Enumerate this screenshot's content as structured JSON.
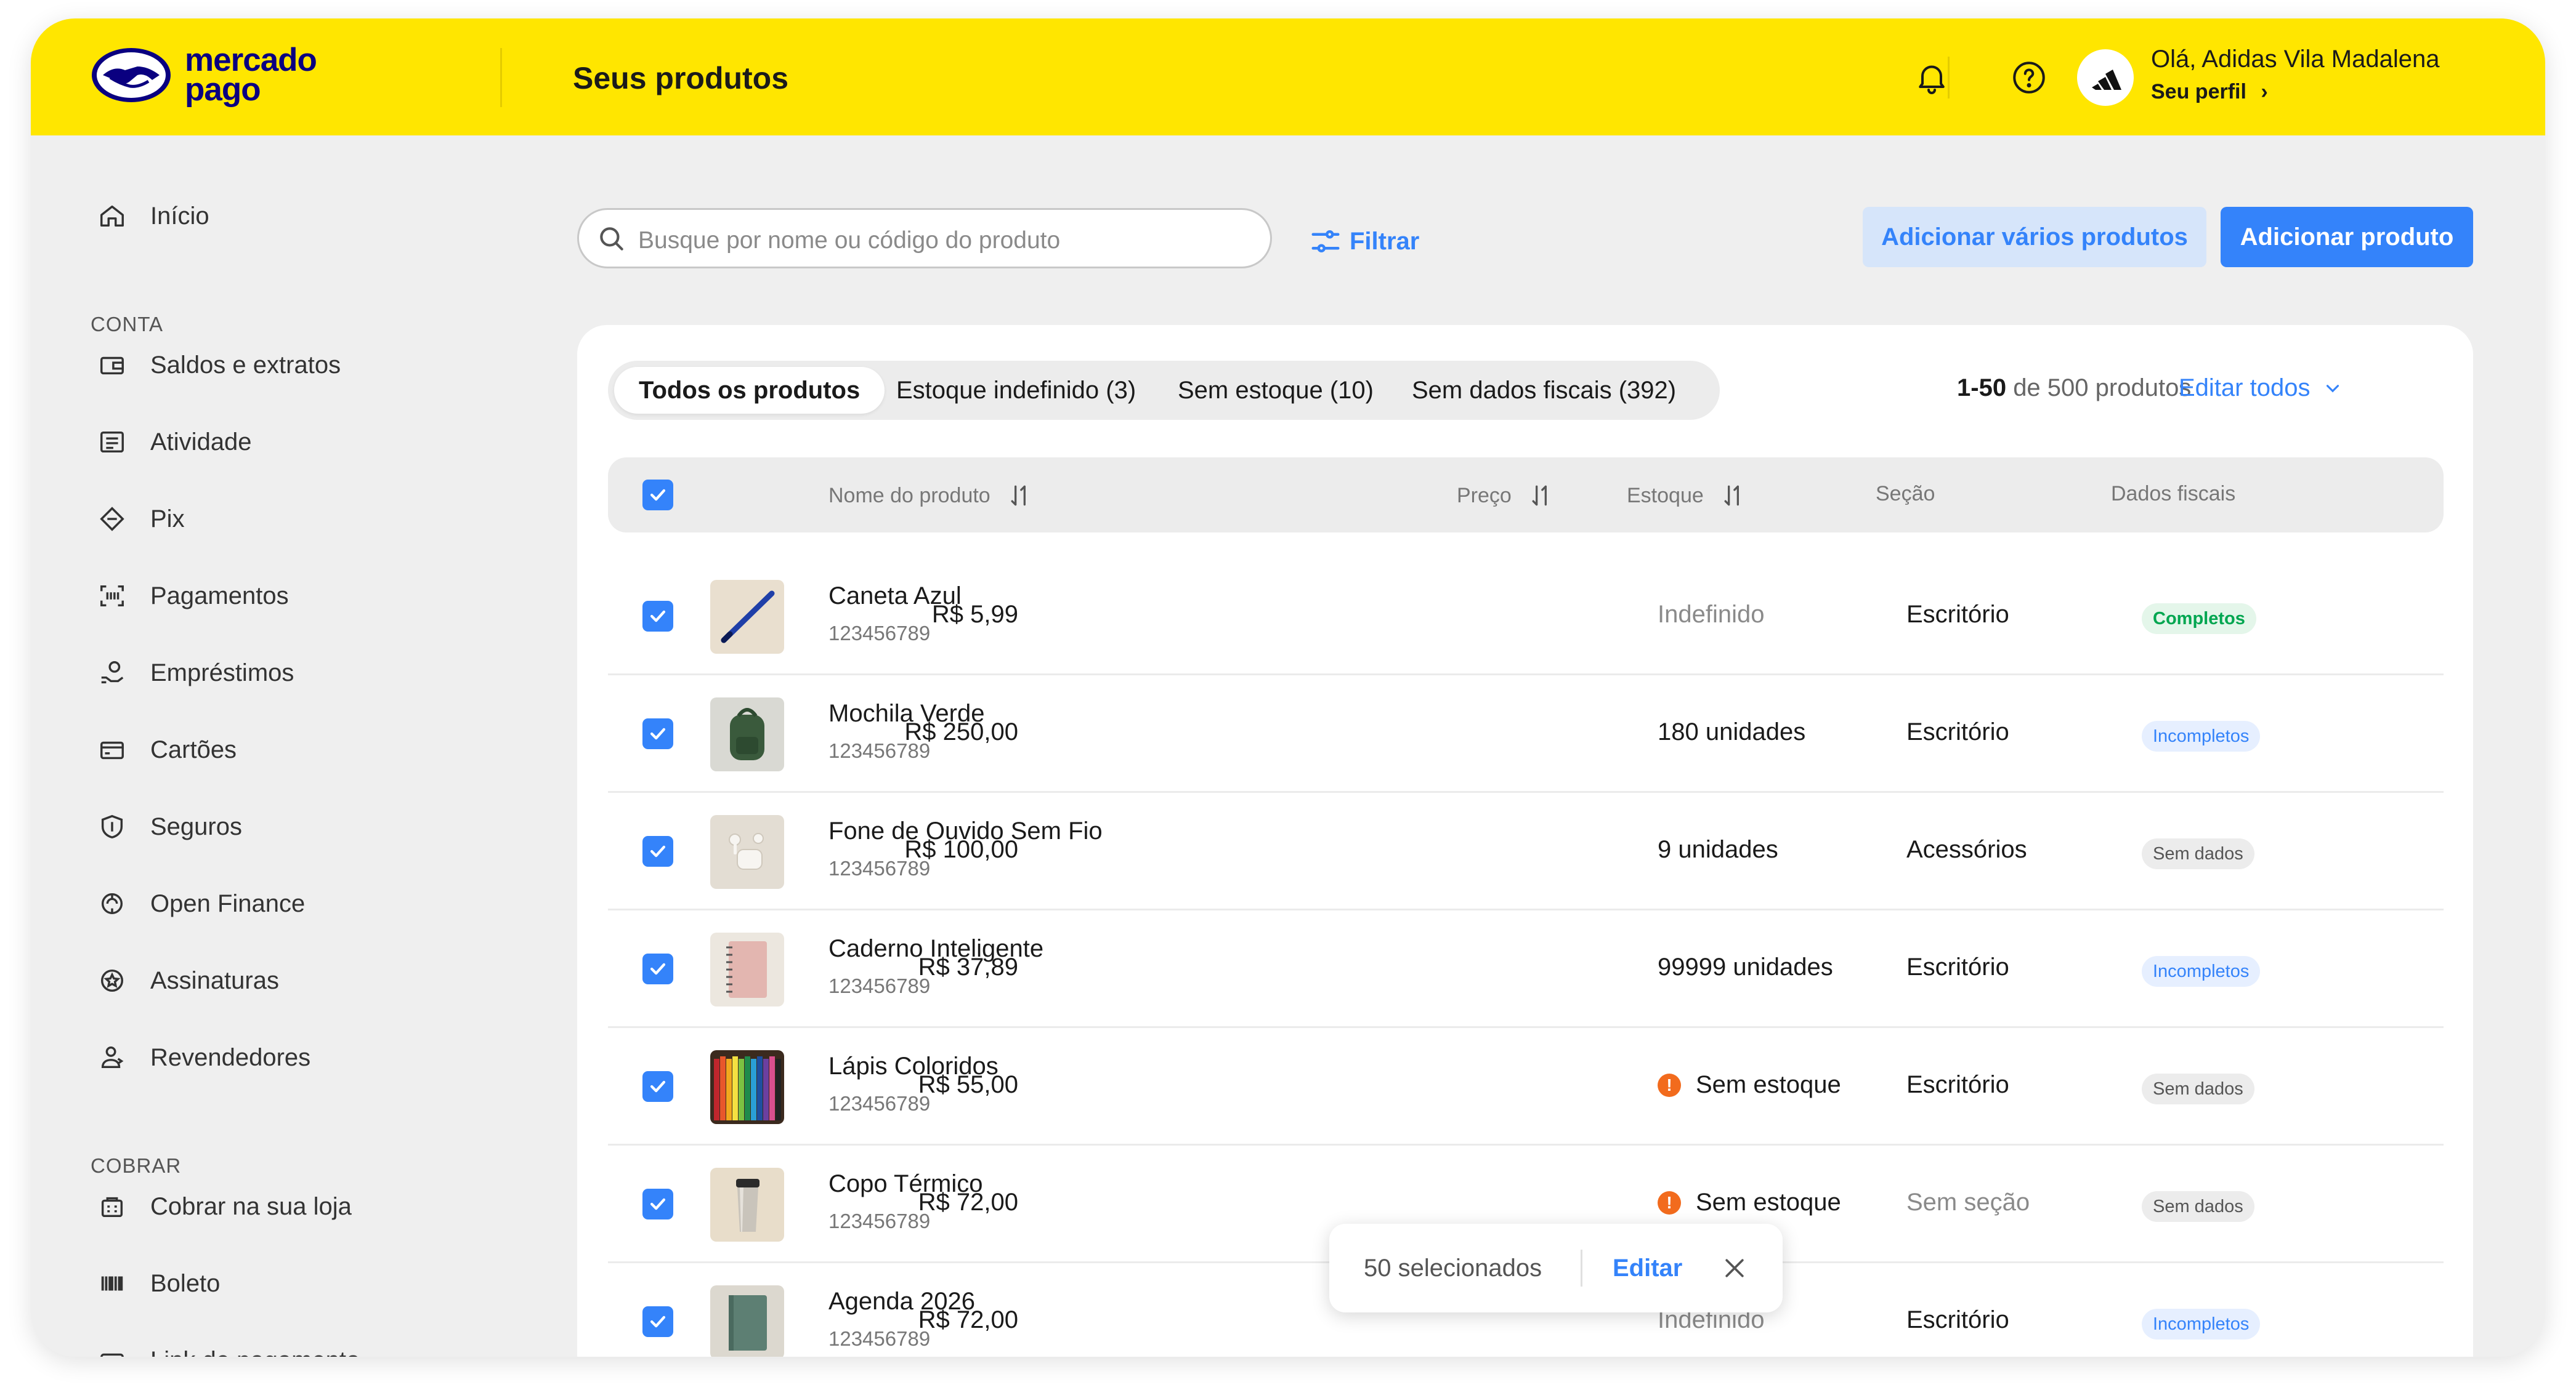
{
  "header": {
    "logo_line1": "mercado",
    "logo_line2": "pago",
    "title": "Seus produtos",
    "greeting": "Olá, Adidas Vila Madalena",
    "profile_link": "Seu perfil",
    "notification_icon": "bell-icon",
    "help_icon": "help-circle-icon",
    "brand_color": "#ffe600"
  },
  "sidebar": {
    "home": {
      "label": "Início",
      "icon": "home-icon"
    },
    "section_account": "CONTA",
    "account_items": [
      {
        "label": "Saldos e extratos",
        "icon": "wallet-icon"
      },
      {
        "label": "Atividade",
        "icon": "list-icon"
      },
      {
        "label": "Pix",
        "icon": "pix-icon"
      },
      {
        "label": "Pagamentos",
        "icon": "scan-icon"
      },
      {
        "label": "Empréstimos",
        "icon": "loan-icon"
      },
      {
        "label": "Cartões",
        "icon": "card-icon"
      },
      {
        "label": "Seguros",
        "icon": "shield-icon"
      },
      {
        "label": "Open Finance",
        "icon": "open-finance-icon"
      },
      {
        "label": "Assinaturas",
        "icon": "subscription-icon"
      },
      {
        "label": "Revendedores",
        "icon": "resellers-icon"
      }
    ],
    "section_charge": "COBRAR",
    "charge_items": [
      {
        "label": "Cobrar na sua loja",
        "icon": "store-icon"
      },
      {
        "label": "Boleto",
        "icon": "barcode-icon"
      },
      {
        "label": "Link de pagamento",
        "icon": "link-icon"
      }
    ]
  },
  "toolbar": {
    "search_placeholder": "Busque por nome ou código do produto",
    "filter_label": "Filtrar",
    "add_many_label": "Adicionar vários produtos",
    "add_product_label": "Adicionar produto"
  },
  "tabs": [
    {
      "label": "Todos os produtos",
      "active": true
    },
    {
      "label": "Estoque indefinido (3)",
      "active": false
    },
    {
      "label": "Sem estoque (10)",
      "active": false
    },
    {
      "label": "Sem dados fiscais (392)",
      "active": false
    }
  ],
  "pagination": {
    "range": "1-50",
    "suffix": "de 500 produtos"
  },
  "edit_all_label": "Editar todos",
  "table": {
    "columns": {
      "name": "Nome do produto",
      "price": "Preço",
      "stock": "Estoque",
      "section": "Seção",
      "fiscal": "Dados fiscais"
    },
    "rows": [
      {
        "name": "Caneta Azul",
        "code": "123456789",
        "price": "R$ 5,99",
        "stock": "Indefinido",
        "stock_state": "undefined",
        "section": "Escritório",
        "fiscal": "Completos",
        "fiscal_state": "complete"
      },
      {
        "name": "Mochila Verde",
        "code": "123456789",
        "price": "R$ 250,00",
        "stock": "180 unidades",
        "stock_state": "ok",
        "section": "Escritório",
        "fiscal": "Incompletos",
        "fiscal_state": "incomplete"
      },
      {
        "name": "Fone de Ouvido Sem Fio",
        "code": "123456789",
        "price": "R$ 100,00",
        "stock": "9 unidades",
        "stock_state": "ok",
        "section": "Acessórios",
        "fiscal": "Sem dados",
        "fiscal_state": "nodata"
      },
      {
        "name": "Caderno Inteligente",
        "code": "123456789",
        "price": "R$ 37,89",
        "stock": "99999 unidades",
        "stock_state": "ok",
        "section": "Escritório",
        "fiscal": "Incompletos",
        "fiscal_state": "incomplete"
      },
      {
        "name": "Lápis Coloridos",
        "code": "123456789",
        "price": "R$ 55,00",
        "stock": "Sem estoque",
        "stock_state": "out",
        "section": "Escritório",
        "fiscal": "Sem dados",
        "fiscal_state": "nodata"
      },
      {
        "name": "Copo Térmico",
        "code": "123456789",
        "price": "R$ 72,00",
        "stock": "Sem estoque",
        "stock_state": "out",
        "section": "Sem seção",
        "fiscal": "Sem dados",
        "fiscal_state": "nodata"
      },
      {
        "name": "Agenda 2026",
        "code": "123456789",
        "price": "R$ 72,00",
        "stock": "Indefinido",
        "stock_state": "undefined",
        "section": "Escritório",
        "fiscal": "Incompletos",
        "fiscal_state": "incomplete"
      }
    ]
  },
  "selection_toast": {
    "selected_text": "50 selecionados",
    "edit_label": "Editar"
  },
  "colors": {
    "accent": "#3483fa",
    "complete": "#00a650",
    "warning": "#f26b1d"
  }
}
